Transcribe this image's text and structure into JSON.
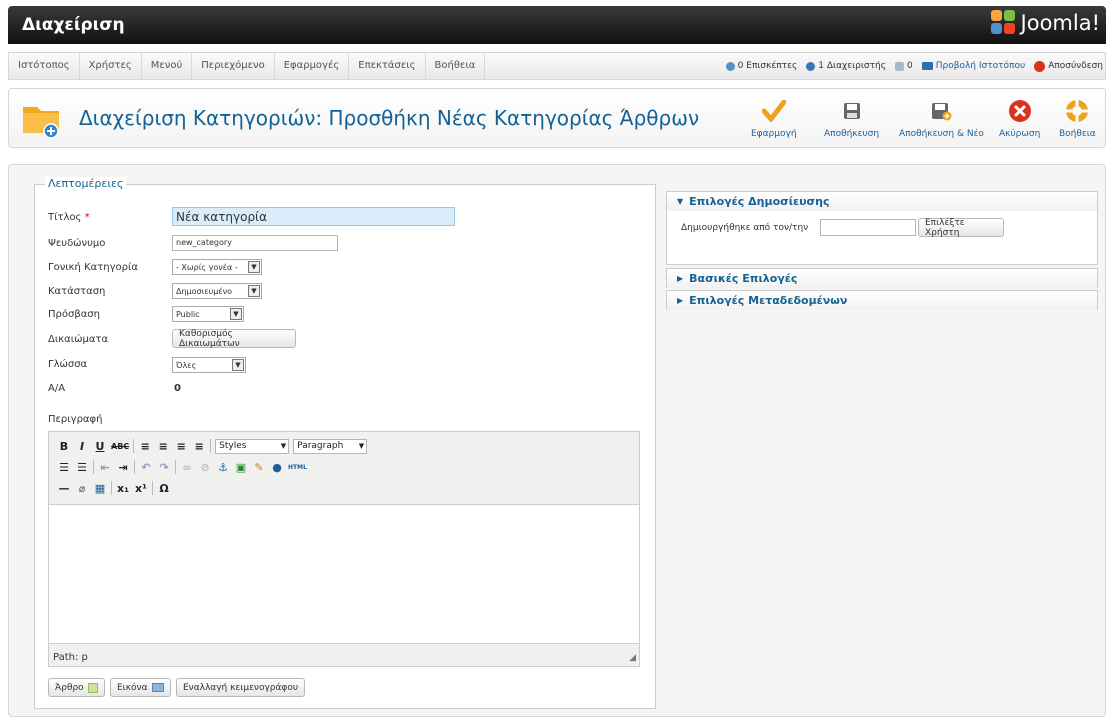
{
  "header": {
    "title": "Διαχείριση",
    "logo_text": "Joomla!"
  },
  "menu": {
    "items": [
      "Ιστότοπος",
      "Χρήστες",
      "Μενού",
      "Περιεχόμενο",
      "Εφαρμογές",
      "Επεκτάσεις",
      "Βοήθεια"
    ]
  },
  "status": {
    "visitors": "0 Επισκέπτες",
    "admins": "1 Διαχειριστής",
    "messages": "0",
    "view_site": "Προβολή Ιστοτόπου",
    "logout": "Αποσύνδεση"
  },
  "toolbar": {
    "page_title": "Διαχείριση Κατηγοριών: Προσθήκη Νέας Κατηγορίας Άρθρων",
    "apply": "Εφαρμογή",
    "save": "Αποθήκευση",
    "save_new": "Αποθήκευση & Νέο",
    "cancel": "Ακύρωση",
    "help": "Βοήθεια"
  },
  "details": {
    "legend": "Λεπτομέρειες",
    "title_label": "Τίτλος",
    "title_required": "*",
    "title_value": "Νέα κατηγορία",
    "alias_label": "Ψευδώνυμο",
    "alias_value": "new_category",
    "parent_label": "Γονική Κατηγορία",
    "parent_value": "- Χωρίς γονέα -",
    "state_label": "Κατάσταση",
    "state_value": "Δημοσιευμένο",
    "access_label": "Πρόσβαση",
    "access_value": "Public",
    "permissions_label": "Δικαιώματα",
    "permissions_button": "Καθορισμός Δικαιωμάτων",
    "language_label": "Γλώσσα",
    "language_value": "Όλες",
    "id_label": "Α/Α",
    "id_value": "0",
    "description_label": "Περιγραφή"
  },
  "editor": {
    "styles": "Styles",
    "format": "Paragraph",
    "path": "Path: p",
    "article_button": "Άρθρο",
    "image_button": "Εικόνα",
    "toggle_button": "Εναλλαγή κειμενογράφου"
  },
  "right": {
    "publishing_title": "Επιλογές Δημοσίευσης",
    "created_by_label": "Δημιουργήθηκε από τον/την",
    "created_by_value": "",
    "select_user_button": "Επιλέξτε Χρήστη",
    "basic_title": "Βασικές Επιλογές",
    "metadata_title": "Επιλογές Μεταδεδομένων"
  },
  "colors": {
    "brand_blue": "#146295",
    "title_input_bg": "#d9ecf9",
    "header_dark": "#1a1a1a"
  }
}
